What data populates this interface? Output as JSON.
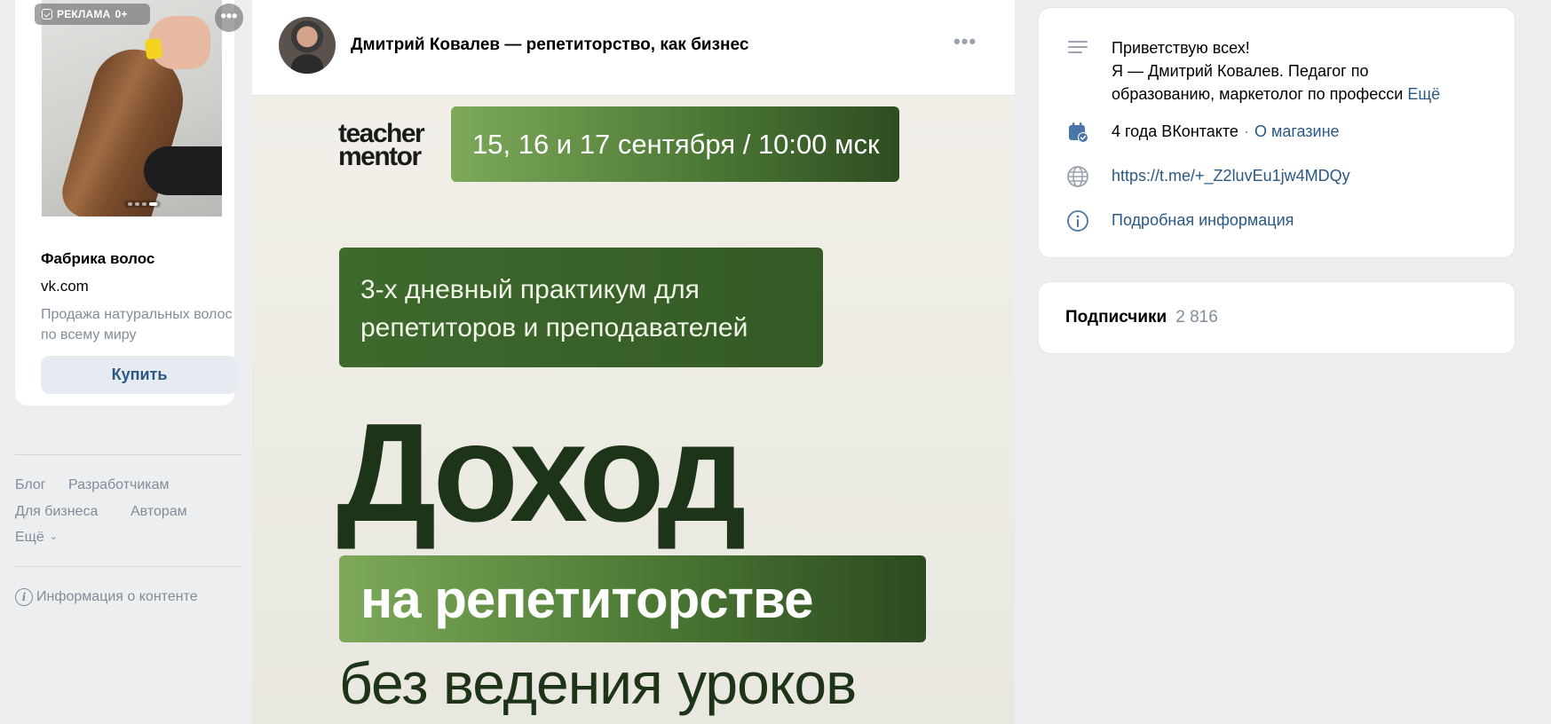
{
  "ad": {
    "badge_label": "РЕКЛАМА",
    "age_label": "0+",
    "more_label": "•••",
    "title": "Фабрика волос",
    "domain": "vk.com",
    "description": "Продажа натуральных волос по всему миру",
    "buy_label": "Купить"
  },
  "footer": {
    "links": [
      "Блог",
      "Разработчикам",
      "Для бизнеса",
      "Авторам",
      "Ещё"
    ],
    "info_label": "Информация о контенте"
  },
  "post": {
    "author": "Дмитрий Ковалев — репетиторство, как бизнес",
    "more_label": "•••",
    "banner": {
      "brand_line1": "teacher",
      "brand_line2": "mentor",
      "dates": "15, 16 и 17 сентября / 10:00 мск",
      "practicum_line1": "3-х дневный практикум для",
      "practicum_line2": "репетиторов и преподавателей",
      "headline_big": "Доход",
      "headline_highlight": "на репетиторстве",
      "headline_bottom": "без ведения уроков"
    }
  },
  "info": {
    "about_line1": "Приветствую всех!",
    "about_line2": "Я — Дмитрий Ковалев. Педагог по",
    "about_line3": "образованию, маркетолог по професси",
    "about_more": "Ещё",
    "years": "4 года ВКонтакте",
    "separator": "·",
    "shop_link": "О магазине",
    "url": "https://t.me/+_Z2luvEu1jw4MDQy",
    "details_link": "Подробная информация"
  },
  "subscribers": {
    "label": "Подписчики",
    "count": "2 816"
  },
  "colors": {
    "accent_link": "#2a5885",
    "muted": "#818c99",
    "banner_green": "#4d7a36"
  }
}
